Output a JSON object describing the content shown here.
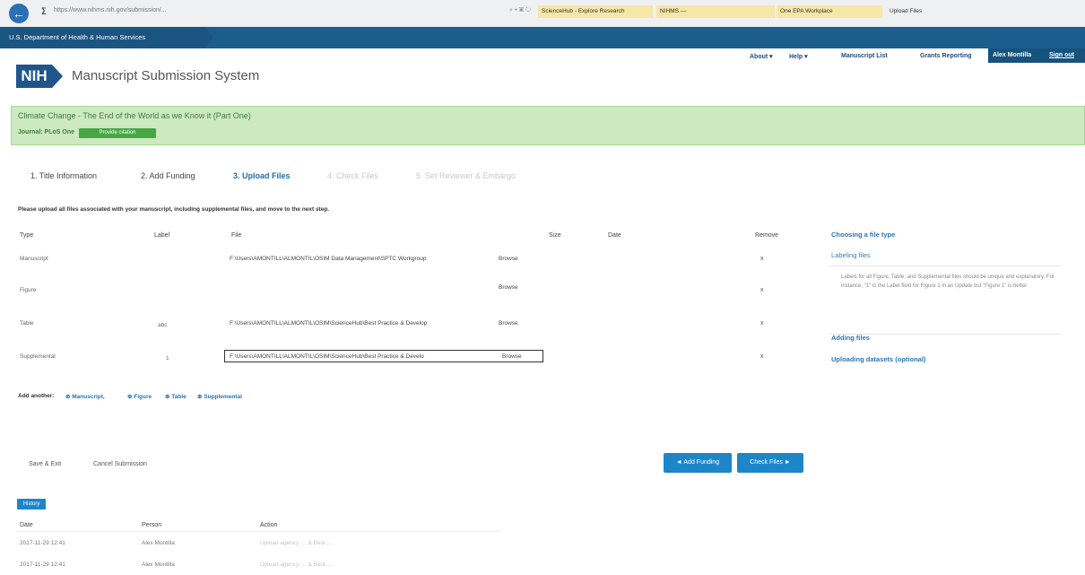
{
  "browser": {
    "url": "https://www.nihms.nih.gov/submission/...",
    "tools": "⌕ ▾ ▣ ↻",
    "tabs": [
      "ScienceHub - Explore Research",
      "NIHMS —",
      "One EPA Workplace",
      "Upload Files"
    ]
  },
  "hhs": {
    "label": "U.S. Department of Health & Human Services"
  },
  "nav": {
    "about": "About ▾",
    "help": "Help ▾",
    "manuscript_list": "Manuscript List",
    "grants_reporting": "Grants Reporting",
    "user": "Alex Montilla",
    "sign_out": "Sign out"
  },
  "logo": {
    "text": "NIH"
  },
  "app_title": "Manuscript Submission System",
  "manuscript": {
    "title": "Climate Change - The End of the World as we Know it (Part One)",
    "journal": "Journal: PLoS One",
    "citation_button": "Provide citation"
  },
  "steps": [
    {
      "label": "1. Title Information",
      "state": "done"
    },
    {
      "label": "2. Add Funding",
      "state": "done"
    },
    {
      "label": "3. Upload Files",
      "state": "active"
    },
    {
      "label": "4. Check Files",
      "state": "future"
    },
    {
      "label": "5. Set Reviewer & Embargo",
      "state": "future"
    }
  ],
  "instructions": "Please upload all files associated with your manuscript, including supplemental files, and move to the next step.",
  "table": {
    "headers": {
      "type": "Type",
      "label": "Label",
      "file": "File",
      "size": "Size",
      "date": "Date",
      "remove": "Remove"
    },
    "rows": [
      {
        "type": "Manuscript",
        "label": "",
        "file": "F:\\Users\\AMONTILL\\ALMONTIL\\OSIM Data Management\\SPTC Workgroup",
        "browse": "Browse",
        "remove": "x"
      },
      {
        "type": "Figure",
        "label": "",
        "file": "",
        "browse": "Browse",
        "remove": "x"
      },
      {
        "type": "Table",
        "label": "abc",
        "file": "F:\\Users\\AMONTILL\\ALMONTIL\\OSIM\\ScienceHub\\Best Practice & Develop",
        "browse": "Browse",
        "remove": "x"
      },
      {
        "type": "Supplemental",
        "label": "1",
        "file": "F:\\Users\\AMONTILL\\ALMONTIL\\OSIM\\ScienceHub\\Best Practice & Develo",
        "browse": "Browse",
        "remove": "x"
      }
    ]
  },
  "help": {
    "choosing": "Choosing a file type",
    "labeling": "Labeling files",
    "labeling_text": "Labels for all Figure, Table, and Supplemental files should be unique and explanatory. For instance, \"1\" is the Label field for Figure 1 in an Update but \"Figure 1\" is better.",
    "adding": "Adding files",
    "datasets": "Uploading datasets (optional)"
  },
  "add_another": {
    "label": "Add another:",
    "manuscript": "⊕ Manuscript,",
    "figure": "⊕ Figure",
    "table": "⊕ Table",
    "supplemental": "⊕ Supplemental"
  },
  "actions": {
    "save_exit": "Save & Exit",
    "cancel": "Cancel Submission",
    "prev": "◄ Add Funding",
    "next": "Check Files ►"
  },
  "history": {
    "button": "History",
    "headers": {
      "date": "Date",
      "person": "Person",
      "action": "Action"
    },
    "rows": [
      {
        "date": "2017-11-29 12:41",
        "person": "Alex Montilla",
        "action": "Upload agency … & Best …"
      },
      {
        "date": "2017-11-29 12:41",
        "person": "Alex Montilla",
        "action": "Upload agency … & Best …"
      }
    ]
  }
}
